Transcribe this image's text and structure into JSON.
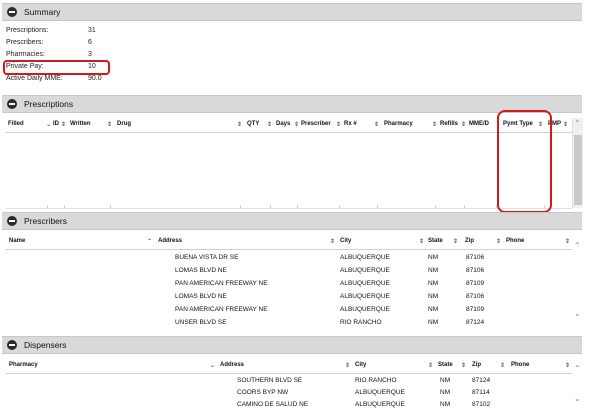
{
  "summary": {
    "title": "Summary",
    "rows": [
      {
        "label": "Prescriptions:",
        "value": "31"
      },
      {
        "label": "Prescribers:",
        "value": "6"
      },
      {
        "label": "Pharmacies:",
        "value": "3"
      },
      {
        "label": "Private Pay:",
        "value": "10"
      },
      {
        "label": "Active Daily MME:",
        "value": "90.0"
      }
    ]
  },
  "prescriptions": {
    "title": "Prescriptions",
    "columns": [
      "Filled",
      "ID",
      "Written",
      "Drug",
      "QTY",
      "Days",
      "Prescriber",
      "Rx #",
      "Pharmacy",
      "Refills",
      "MME/D",
      "Pymt Type",
      "PMP"
    ]
  },
  "prescribers": {
    "title": "Prescribers",
    "columns": [
      "Name",
      "Address",
      "City",
      "State",
      "Zip",
      "Phone"
    ],
    "rows": [
      {
        "address": "BUENA VISTA DR SE",
        "city": "ALBUQUERQUE",
        "state": "NM",
        "zip": "87106"
      },
      {
        "address": "LOMAS BLVD NE",
        "city": "ALBUQUERQUE",
        "state": "NM",
        "zip": "87106"
      },
      {
        "address": "PAN AMERICAN FREEWAY NE",
        "city": "ALBUQUERQUE",
        "state": "NM",
        "zip": "87109"
      },
      {
        "address": "LOMAS BLVD NE",
        "city": "ALBUQUERQUE",
        "state": "NM",
        "zip": "87106"
      },
      {
        "address": "PAN AMERICAN FREEWAY NE",
        "city": "ALBUQUERQUE",
        "state": "NM",
        "zip": "87109"
      },
      {
        "address": "UNSER BLVD SE",
        "city": "RIO RANCHO",
        "state": "NM",
        "zip": "87124"
      }
    ]
  },
  "dispensers": {
    "title": "Dispensers",
    "columns": [
      "Pharmacy",
      "Address",
      "City",
      "State",
      "Zip",
      "Phone"
    ],
    "rows": [
      {
        "address": "SOUTHERN BLVD SE",
        "city": "RIO RANCHO",
        "state": "NM",
        "zip": "87124"
      },
      {
        "address": "COORS BYP NW",
        "city": "ALBUQUERQUE",
        "state": "NM",
        "zip": "87114"
      },
      {
        "address": "CAMINO DE SALUD NE",
        "city": "ALBUQUERQUE",
        "state": "NM",
        "zip": "87102"
      }
    ]
  },
  "colors": {
    "highlight": "#d11a1a",
    "header_bg": "#d9d9d9"
  }
}
